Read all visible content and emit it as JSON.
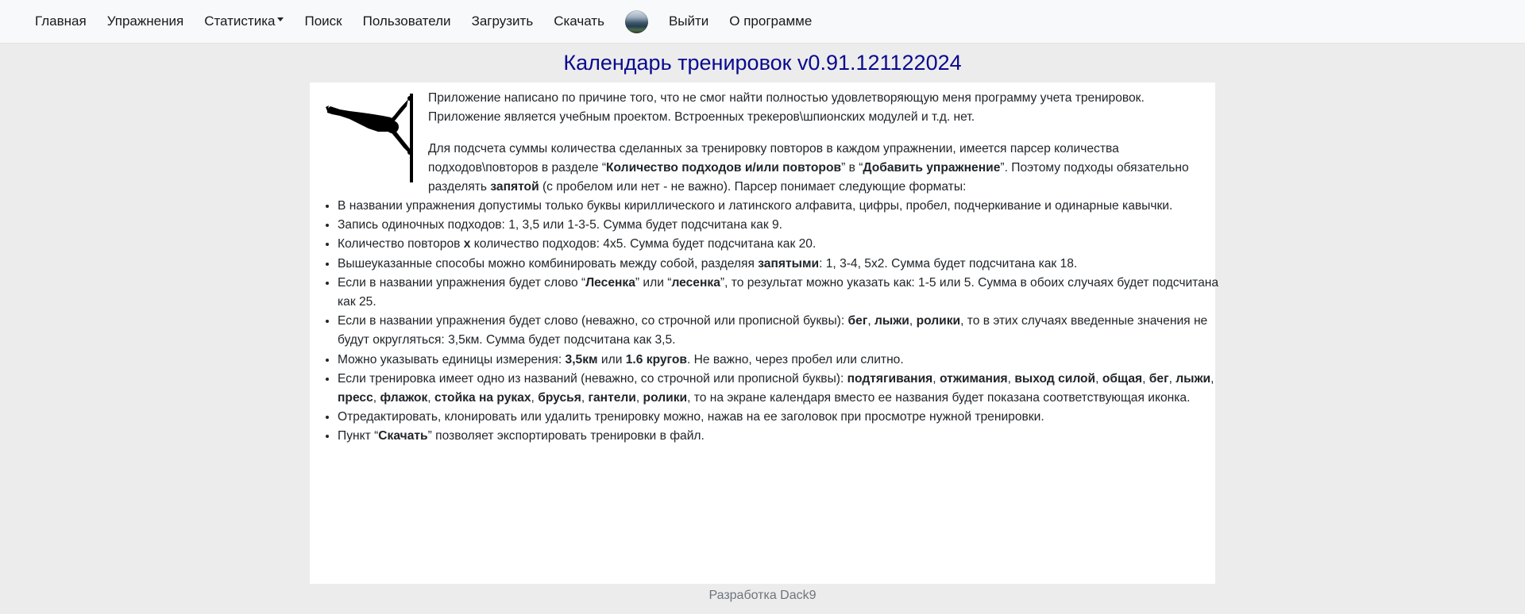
{
  "nav": {
    "home": "Главная",
    "exercises": "Упражнения",
    "statistics": "Статистика",
    "search": "Поиск",
    "users": "Пользователи",
    "upload": "Загрузить",
    "download": "Скачать",
    "logout": "Выйти",
    "about": "О программе"
  },
  "title": "Календарь тренировок v0.91.121122024",
  "intro": {
    "p1_line1": "Приложение написано по причине того, что не смог найти полностью удовлетворяющую меня программу учета тренировок.",
    "p1_line2": "Приложение является учебным проектом. Встроенных трекеров\\шпионских модулей и т.д. нет.",
    "p2_a": "Для подсчета суммы количества сделанных за тренировку повторов в каждом упражнении, имеется парсер количества подходов\\повторов в разделе “",
    "p2_b": "Количество подходов и/или повторов",
    "p2_c": "” в “",
    "p2_d": "Добавить упражнение",
    "p2_e": "”. Поэтому подходы обязательно разделять ",
    "p2_f": "запятой",
    "p2_g": " (с пробелом или нет - не важно). Парсер понимает следующие форматы:"
  },
  "rules": {
    "r1": "В названии упражнения допустимы только буквы кириллического и латинского алфавита, цифры, пробел, подчеркивание и одинарные кавычки.",
    "r2": "Запись одиночных подходов: 1, 3,5 или 1-3-5. Сумма будет подсчитана как 9.",
    "r3_a": "Количество повторов ",
    "r3_b": "x",
    "r3_c": " количество подходов: 4x5. Сумма будет подсчитана как 20.",
    "r4_a": "Вышеуказанные способы можно комбинировать между собой, разделяя ",
    "r4_b": "запятыми",
    "r4_c": ": 1, 3-4, 5x2. Сумма будет подсчитана как 18.",
    "r5_a": "Если в названии упражнения будет слово “",
    "r5_b": "Лесенка",
    "r5_c": "” или “",
    "r5_d": "лесенка",
    "r5_e": "”, то результат можно указать как: 1-5 или 5. Сумма в обоих случаях будет подсчитана как 25.",
    "r6_a": "Если в названии упражнения будет слово (неважно, со строчной или прописной буквы): ",
    "r6_b": "бег",
    "r6_c": "лыжи",
    "r6_d": "ролики",
    "r6_e": ", то в этих случаях введенные значения не будут округляться: 3,5км. Сумма будет подсчитана как 3,5.",
    "r7_a": "Можно указывать единицы измерения: ",
    "r7_b": "3,5км",
    "r7_c": " или ",
    "r7_d": "1.6 кругов",
    "r7_e": ". Не важно, через пробел или слитно.",
    "r8_a": "Если тренировка имеет одно из названий (неважно, со строчной или прописной буквы): ",
    "r8_items": [
      "подтягивания",
      "отжимания",
      "выход силой",
      "общая",
      "бег",
      "лыжи",
      "пресс",
      "флажок",
      "стойка на руках",
      "брусья",
      "гантели",
      "ролики"
    ],
    "r8_e": ", то на экране календаря вместо ее названия будет показана соответствующая иконка.",
    "r9": "Отредактировать, клонировать или удалить тренировку можно, нажав на ее заголовок при просмотре нужной тренировки.",
    "r10_a": "Пункт “",
    "r10_b": "Скачать",
    "r10_c": "” позволяет экспортировать тренировки в файл."
  },
  "footer": "Разработка Dack9",
  "colors": {
    "title": "#0a0a8f",
    "background": "#ececec",
    "navbar": "#f8f9fa",
    "footer": "#6c757d"
  },
  "icons": {
    "logo": "human-flag-silhouette",
    "avatar": "user-avatar",
    "statistics_caret": "caret-down"
  }
}
